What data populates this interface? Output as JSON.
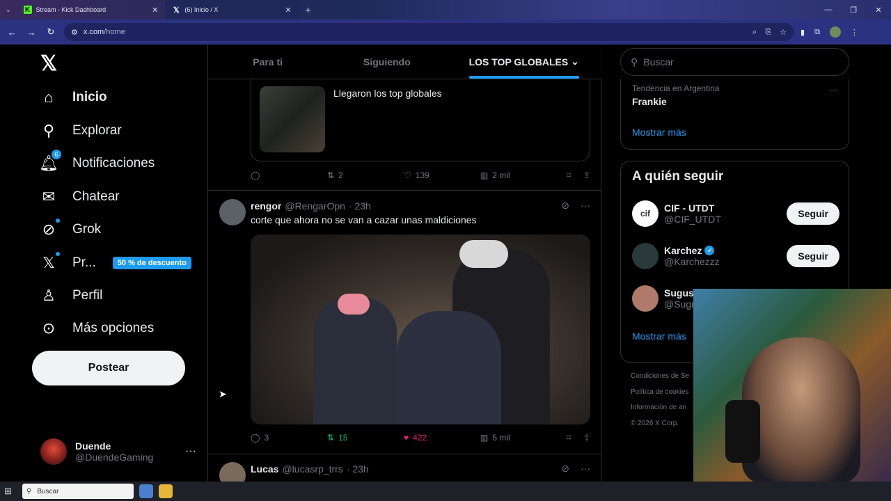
{
  "browser": {
    "tabs": [
      {
        "label": "Stream - Kick Dashboard",
        "icon": "kick-icon"
      },
      {
        "label": "(6) Inicio / X",
        "icon": "x-icon"
      }
    ],
    "url_domain": "x.com",
    "url_path": "/home"
  },
  "nav": {
    "items": [
      {
        "label": "Inicio",
        "icon": "home-icon"
      },
      {
        "label": "Explorar",
        "icon": "search-icon"
      },
      {
        "label": "Notificaciones",
        "icon": "bell-icon",
        "badge": "6"
      },
      {
        "label": "Chatear",
        "icon": "mail-icon"
      },
      {
        "label": "Grok",
        "icon": "grok-icon"
      },
      {
        "label": "Pr...",
        "icon": "x-premium-icon",
        "promo": "50 % de descuento"
      },
      {
        "label": "Perfil",
        "icon": "person-icon"
      },
      {
        "label": "Más opciones",
        "icon": "more-circle-icon"
      }
    ],
    "post_button": "Postear",
    "account": {
      "name": "Duende",
      "handle": "@DuendeGaming"
    }
  },
  "feed": {
    "tabs": [
      "Para ti",
      "Siguiendo",
      "LOS TOP GLOBALES"
    ],
    "active_tab": "LOS TOP GLOBALES",
    "quote": {
      "text": "Llegaron los top globales"
    },
    "tweet1_stats": {
      "replies": "",
      "retweets": "2",
      "likes": "139",
      "views": "2 mil"
    },
    "tweet2": {
      "name": "rengor",
      "handle": "@RengarOpn",
      "time": "· 23h",
      "text": "corte que ahora no se van a cazar unas maldiciones",
      "replies": "3",
      "retweets": "15",
      "likes": "422",
      "views": "5 mil"
    },
    "tweet3": {
      "name": "Lucas",
      "handle": "@lucasrp_trrs",
      "time": "· 23h"
    }
  },
  "sidebar": {
    "search_placeholder": "Buscar",
    "trend": {
      "meta": "Tendencia en Argentina",
      "name": "Frankie"
    },
    "show_more": "Mostrar más",
    "follow_title": "A quién seguir",
    "follow_button": "Seguir",
    "suggestions": [
      {
        "name": "CIF - UTDT",
        "handle": "@CIF_UTDT",
        "avatar_color": "#ffffff"
      },
      {
        "name": "Karchez",
        "handle": "@Karchezzz",
        "verified": true,
        "avatar_color": "#2a3a3a"
      },
      {
        "name": "Sugus",
        "handle": "@Sugu",
        "avatar_color": "#b07a6a"
      }
    ],
    "footer": [
      "Condiciones de Se",
      "Política de cookies",
      "Información de an",
      "© 2026 X Corp."
    ]
  },
  "taskbar": {
    "search_placeholder": "Buscar"
  },
  "colors": {
    "accent": "#1d9bf0",
    "like": "#f91880",
    "retweet": "#00ba7c"
  }
}
